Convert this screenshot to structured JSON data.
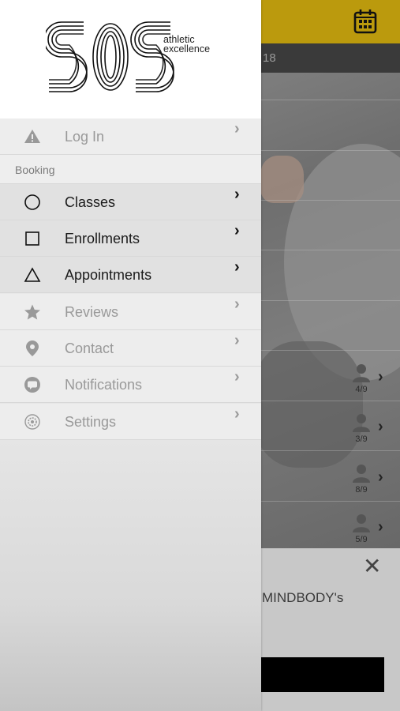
{
  "background": {
    "date_fragment": "18",
    "rows": [
      {
        "count": "4/9"
      },
      {
        "count": "3/9"
      },
      {
        "count": "8/9"
      },
      {
        "count": "5/9"
      }
    ],
    "banner": {
      "text": "MINDBODY's",
      "close_glyph": "✕"
    },
    "colors": {
      "header": "#bb9a0d"
    }
  },
  "drawer": {
    "logo": {
      "mark": "SOS",
      "tagline_line1": "athletic",
      "tagline_line2": "excellence"
    },
    "items_top": [
      {
        "label": "Log In",
        "icon": "warning-icon",
        "active": false
      }
    ],
    "section_title": "Booking",
    "items_booking": [
      {
        "label": "Classes",
        "icon": "circle-icon",
        "active": true
      },
      {
        "label": "Enrollments",
        "icon": "square-icon",
        "active": true
      },
      {
        "label": "Appointments",
        "icon": "triangle-icon",
        "active": true
      },
      {
        "label": "Reviews",
        "icon": "star-icon",
        "active": false
      },
      {
        "label": "Contact",
        "icon": "location-pin-icon",
        "active": false
      },
      {
        "label": "Notifications",
        "icon": "chat-bubble-icon",
        "active": false
      },
      {
        "label": "Settings",
        "icon": "gear-icon",
        "active": false
      }
    ],
    "chevron": "›"
  }
}
